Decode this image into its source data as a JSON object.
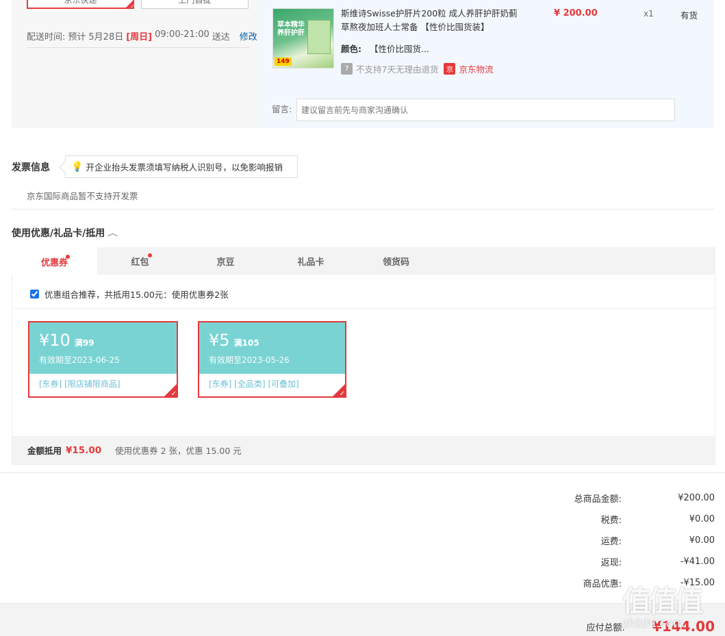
{
  "shipping": {
    "options": [
      "京东快递",
      "上门自提"
    ],
    "delivery_label": "配送时间:",
    "delivery_expect": "预计",
    "delivery_date": "5月28日",
    "delivery_weekday": "[周日]",
    "delivery_window": "09:00-21:00",
    "delivery_suffix": "送达",
    "modify_label": "修改"
  },
  "product": {
    "title": "斯维诗Swisse护肝片200粒 成人养肝护肝奶蓟草熬夜加班人士常备 【性价比囤货装】",
    "price": "¥ 200.00",
    "qty": "x1",
    "stock": "有货",
    "color_label": "颜色:",
    "color_value": "【性价比囤货...",
    "no_return_badge": "7",
    "no_return_text": "不支持7天无理由退货",
    "jd_badge": "京",
    "jd_logistics": "京东物流",
    "image_text": "草本精华 养肝护肝",
    "image_badge": "149",
    "memo_label": "留言:",
    "memo_placeholder": "建议留言前先与商家沟通确认"
  },
  "invoice": {
    "title": "发票信息",
    "tip": "开企业抬头发票须填写纳税人识别号，以免影响报销",
    "note": "京东国际商品暂不支持开发票"
  },
  "coupons": {
    "title": "使用优惠/礼品卡/抵用",
    "tabs": [
      "优惠券",
      "红包",
      "京豆",
      "礼品卡",
      "领货码"
    ],
    "recommend_text": "优惠组合推荐，共抵用15.00元：使用优惠券2张",
    "recommend_checked": true,
    "items": [
      {
        "amount": "¥10",
        "condition": "满99",
        "expiry": "有效期至2023-06-25",
        "tags": "[东券] [限店铺限商品]"
      },
      {
        "amount": "¥5",
        "condition": "满105",
        "expiry": "有效期至2023-05-26",
        "tags": "[东券] [全品类] [可叠加]"
      }
    ],
    "summary_label": "金额抵用",
    "summary_amount": "¥15.00",
    "summary_text": "使用优惠券 2 张，优惠 15.00 元"
  },
  "totals": [
    {
      "label": "总商品金额:",
      "value": "¥200.00"
    },
    {
      "label": "税费:",
      "value": "¥0.00"
    },
    {
      "label": "运费:",
      "value": "¥0.00"
    },
    {
      "label": "返现:",
      "value": "-¥41.00"
    },
    {
      "label": "商品优惠:",
      "value": "-¥15.00"
    }
  ],
  "payable": {
    "label": "应付总额:",
    "value": "¥144.00"
  },
  "watermark": {
    "logo": "值值值",
    "site": "zhizhi.com"
  },
  "colors": {
    "accent": "#e4393c",
    "coupon": "#7ad3d3",
    "link": "#005ea7"
  }
}
